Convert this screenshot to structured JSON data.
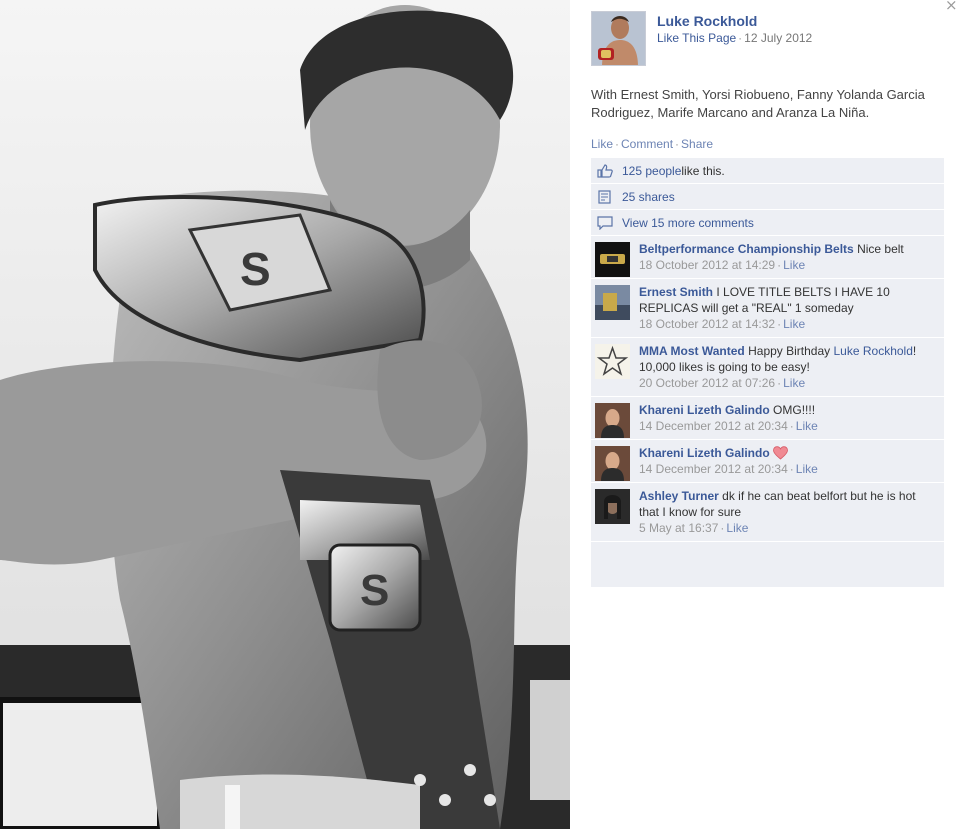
{
  "window": {
    "close_glyph": "×"
  },
  "post": {
    "page_name": "Luke Rockhold",
    "like_page": "Like This Page",
    "date": "12 July 2012",
    "caption_line1": "With Ernest Smith, Yorsi Riobueno, Fanny Yolanda Garcia",
    "caption_line2": "Rodriguez, Marife Marcano and Aranza La Niña.",
    "actions": {
      "like": "Like",
      "comment": "Comment",
      "share": "Share"
    }
  },
  "ufi": {
    "likes_count": "125 people",
    "likes_suffix": " like this.",
    "shares": "25 shares",
    "view_more": "View 15 more comments"
  },
  "comments": [
    {
      "author": "Beltperformance Championship Belts",
      "text": "Nice belt",
      "time": "18 October 2012 at 14:29",
      "like": "Like"
    },
    {
      "author": "Ernest Smith",
      "text": "I LOVE TITLE BELTS I HAVE 10 REPLICAS will get a \"REAL\" 1 someday",
      "time": "18 October 2012 at 14:32",
      "like": "Like"
    },
    {
      "author": "MMA Most Wanted",
      "text_before": "Happy Birthday",
      "mention": "Luke Rockhold",
      "text_after": "! 10,000 likes is going to be easy!",
      "time": "20 October 2012 at 07:26",
      "like": "Like"
    },
    {
      "author": "Khareni Lizeth Galindo",
      "text": "OMG!!!!",
      "time": "14 December 2012 at 20:34",
      "like": "Like"
    },
    {
      "author": "Khareni Lizeth Galindo",
      "text": "",
      "time": "14 December 2012 at 20:34",
      "like": "Like"
    },
    {
      "author": "Ashley Turner",
      "text": "dk if he can beat belfort but he is hot that I know for sure",
      "time": "5 May at 16:37",
      "like": "Like"
    }
  ],
  "icons": {
    "likes": "thumbs-up-icon",
    "shares": "share-icon",
    "comments": "comment-bubble-icon",
    "reaction": "heart-icon"
  },
  "colors": {
    "link": "#3b5998",
    "ufi_bg": "#edeff4",
    "heart": "#e56a75"
  }
}
